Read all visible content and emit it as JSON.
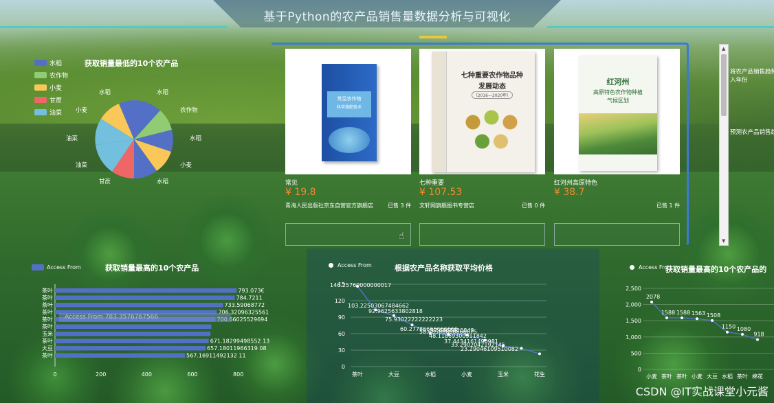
{
  "header": {
    "title": "基于Python的农产品销售量数据分析与可视化"
  },
  "pie_panel": {
    "title": "获取销量最低的10个农产品",
    "legend": [
      {
        "label": "水稻",
        "color": "#5470c6"
      },
      {
        "label": "农作物",
        "color": "#91cc75"
      },
      {
        "label": "小麦",
        "color": "#fac858"
      },
      {
        "label": "甘蔗",
        "color": "#ee6666"
      },
      {
        "label": "油菜",
        "color": "#73c0de"
      }
    ],
    "slice_labels": [
      "水稻",
      "水稻",
      "农作物",
      "水稻",
      "小麦",
      "水稻",
      "甘蔗",
      "油菜",
      "油菜",
      "小麦"
    ]
  },
  "books": {
    "items": [
      {
        "name": "常见",
        "price": "¥ 19.8",
        "shop": "青海人民出版社京东自营官方旗舰店",
        "sold": "已售 3 件",
        "cover_title": "常见农作物",
        "cover_sub": "科学施肥技术"
      },
      {
        "name": "七种重要",
        "price": "¥ 107.53",
        "shop": "文轩网旗舰图书专营店",
        "sold": "已售 0 件",
        "cover_title": "七种重要农作物品种",
        "cover_sub": "发展动态",
        "cover_years": "（2016—2020年）"
      },
      {
        "name": "红河州高原特色",
        "price": "¥ 38.7",
        "shop": "",
        "sold": "已售 1 件",
        "cover_title": "红河州",
        "cover_sub": "高原特色农作物种植",
        "cover_sub2": "气候区划"
      }
    ]
  },
  "right_sidebar": {
    "line1": "将农产品销售趋势",
    "line2": "入年份",
    "line3": "预测农产品销售趋"
  },
  "bar_panel": {
    "legend_label": "Access From",
    "title": "获取销量最高的10个农产品",
    "tooltip": "Access From 783.3576767566",
    "chart_data": {
      "type": "bar",
      "orientation": "horizontal",
      "categories": [
        "茶叶",
        "茶叶",
        "茶叶",
        "茶叶",
        "茶叶",
        "茶叶",
        "玉米",
        "茶叶",
        "大豆",
        "茶叶"
      ],
      "values": [
        793.073,
        784.7211,
        733.59068772,
        706.3209632556,
        700.6602552969,
        682.3022,
        678.5,
        671.1829949855213,
        657.1801196631908,
        567.1691149213211
      ],
      "value_labels": [
        "793.073€",
        "784.7211",
        "733.59068772",
        "706.32096325561",
        "700.66025529694",
        "",
        "",
        "671.18299498552 13",
        "657.18011966319 08",
        "567.16911492132 11"
      ],
      "xticks": [
        "0",
        "200",
        "400",
        "600",
        "800"
      ],
      "xlim": [
        0,
        900
      ]
    }
  },
  "line_panel": {
    "legend_label": "Access From",
    "title": "根据农产品名称获取平均价格",
    "chart_data": {
      "type": "line",
      "categories": [
        "茶叶",
        "大豆",
        "水稻",
        "小麦",
        "玉米",
        "花生"
      ],
      "ylim": [
        0,
        150
      ],
      "yticks": [
        "0",
        "30",
        "60",
        "90",
        "120",
        "15"
      ],
      "point_labels": [
        "146.25760000000017",
        "103.22503067484662",
        "92.9625633802818",
        "75.93022222222223",
        "60.27786666666666",
        "58.68566666666675",
        "57.6968920848",
        "48.11869300911842",
        "37.4434161490981",
        "33.2902042192145",
        "23.29046109510082"
      ],
      "values": [
        146.26,
        103.23,
        92.96,
        75.93,
        60.28,
        58.69,
        57.7,
        48.12,
        37.44,
        33.29,
        23.29
      ]
    }
  },
  "right_panel": {
    "legend_label": "Access Fro",
    "title": "获取销量最高的10个农产品的",
    "chart_data": {
      "type": "line",
      "categories": [
        "小麦",
        "茶叶",
        "茶叶",
        "小麦",
        "大豆",
        "水稻",
        "茶叶",
        "棉花"
      ],
      "values": [
        2078,
        1588,
        1588,
        1563,
        1508,
        1150,
        1080,
        918
      ],
      "yticks": [
        "0",
        "500",
        "1,000",
        "1,500",
        "2,000",
        "2,500"
      ],
      "ylim": [
        0,
        2500
      ]
    }
  },
  "watermark": "CSDN @IT实战课堂小元酱"
}
